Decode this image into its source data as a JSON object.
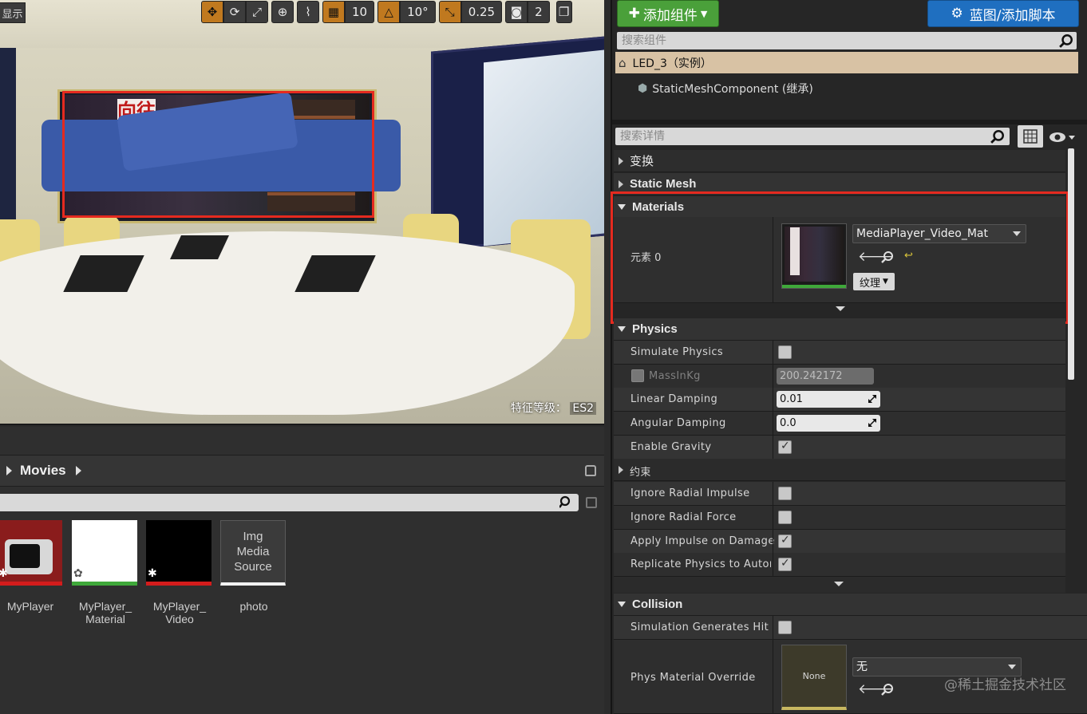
{
  "viewport": {
    "show_label": "显示",
    "grid_value": "10",
    "rotation_snap": "10°",
    "scale_snap": "0.25",
    "camera_speed": "2",
    "feature_level_label": "特征等级：",
    "feature_level_value": "ES2",
    "scene_banner_text": "向往的",
    "colors": {
      "highlight": "#e52a1f",
      "orange": "#c0791f"
    }
  },
  "content_browser": {
    "path_label": "Movies",
    "assets": [
      {
        "label": "MyPlayer",
        "icon": "tv-icon",
        "bar": "#d41c1c"
      },
      {
        "label": "MyPlayer_\nMaterial",
        "icon": "material-icon",
        "bar": "#3fa83a"
      },
      {
        "label": "MyPlayer_\nVideo",
        "icon": "video-icon",
        "bar": "#d41c1c"
      },
      {
        "label": "photo",
        "thumb_text": "Img\nMedia\nSource",
        "bar": "#ffffff"
      }
    ]
  },
  "components": {
    "add_button": "添加组件",
    "blueprint_button": "蓝图/添加脚本",
    "search_placeholder": "搜索组件",
    "root": "LED_3（实例）",
    "child": "StaticMeshComponent (继承)"
  },
  "details": {
    "search_placeholder": "搜索详情",
    "sections": {
      "transform": "变换",
      "static_mesh": "Static Mesh",
      "materials": "Materials",
      "physics": "Physics",
      "collision": "Collision"
    },
    "materials": {
      "element_label": "元素 0",
      "material_name": "MediaPlayer_Video_Mat",
      "texture_button": "纹理"
    },
    "physics": {
      "simulate_physics": {
        "label": "Simulate Physics",
        "checked": false
      },
      "mass": {
        "label": "MassInKg",
        "value": "200.242172"
      },
      "linear_damping": {
        "label": "Linear Damping",
        "value": "0.01"
      },
      "angular_damping": {
        "label": "Angular Damping",
        "value": "0.0"
      },
      "enable_gravity": {
        "label": "Enable Gravity",
        "checked": true
      },
      "constraints": "约束",
      "ignore_radial_impulse": {
        "label": "Ignore Radial Impulse",
        "checked": false
      },
      "ignore_radial_force": {
        "label": "Ignore Radial Force",
        "checked": false
      },
      "apply_impulse_on_damage": {
        "label": "Apply Impulse on Damage",
        "checked": true
      },
      "replicate_physics": {
        "label": "Replicate Physics to Auton",
        "checked": true
      }
    },
    "collision": {
      "sim_generates_hit": {
        "label": "Simulation Generates Hit E",
        "checked": false
      },
      "phys_material_override": {
        "label": "Phys Material Override",
        "thumb_text": "None",
        "dropdown_value": "无"
      }
    }
  },
  "watermark": "@稀土掘金技术社区"
}
